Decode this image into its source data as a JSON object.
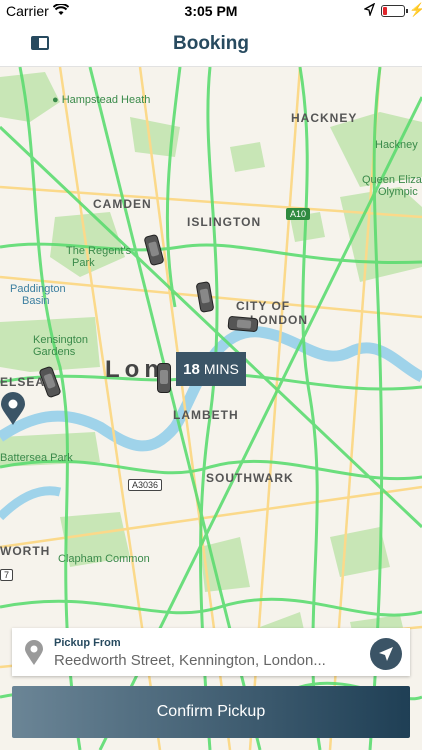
{
  "status_bar": {
    "carrier": "Carrier",
    "time": "3:05 PM",
    "bolt": "⚡"
  },
  "nav": {
    "title": "Booking"
  },
  "map": {
    "labels": {
      "hackney": "HACKNEY",
      "camden": "CAMDEN",
      "islington": "ISLINGTON",
      "city_of_london_1": "CITY OF",
      "city_of_london_2": "LONDON",
      "london": "Lon",
      "lambeth": "LAMBETH",
      "southwark": "SOUTHWARK",
      "chelsea": "ELSEA",
      "worth": "WORTH"
    },
    "parks": {
      "hampstead_heath": "Hampstead Heath",
      "hackney_marshes": "Hackney",
      "queen_eliz_1": "Queen Eliza",
      "queen_eliz_2": "Olympic",
      "regents_park_1": "The Regent's",
      "regents_park_2": "Park",
      "paddington_1": "Paddington",
      "paddington_2": "Basin",
      "kensington_1": "Kensington",
      "kensington_2": "Gardens",
      "battersea": "Battersea Park",
      "clapham": "Clapham Common"
    },
    "roads": {
      "a10": "A10",
      "a3036": "A3036",
      "a7": "7"
    }
  },
  "eta": {
    "value": "18",
    "unit": "MINS"
  },
  "pickup": {
    "label": "Pickup From",
    "address": "Reedworth Street, Kennington, London..."
  },
  "confirm": {
    "label": "Confirm Pickup"
  }
}
